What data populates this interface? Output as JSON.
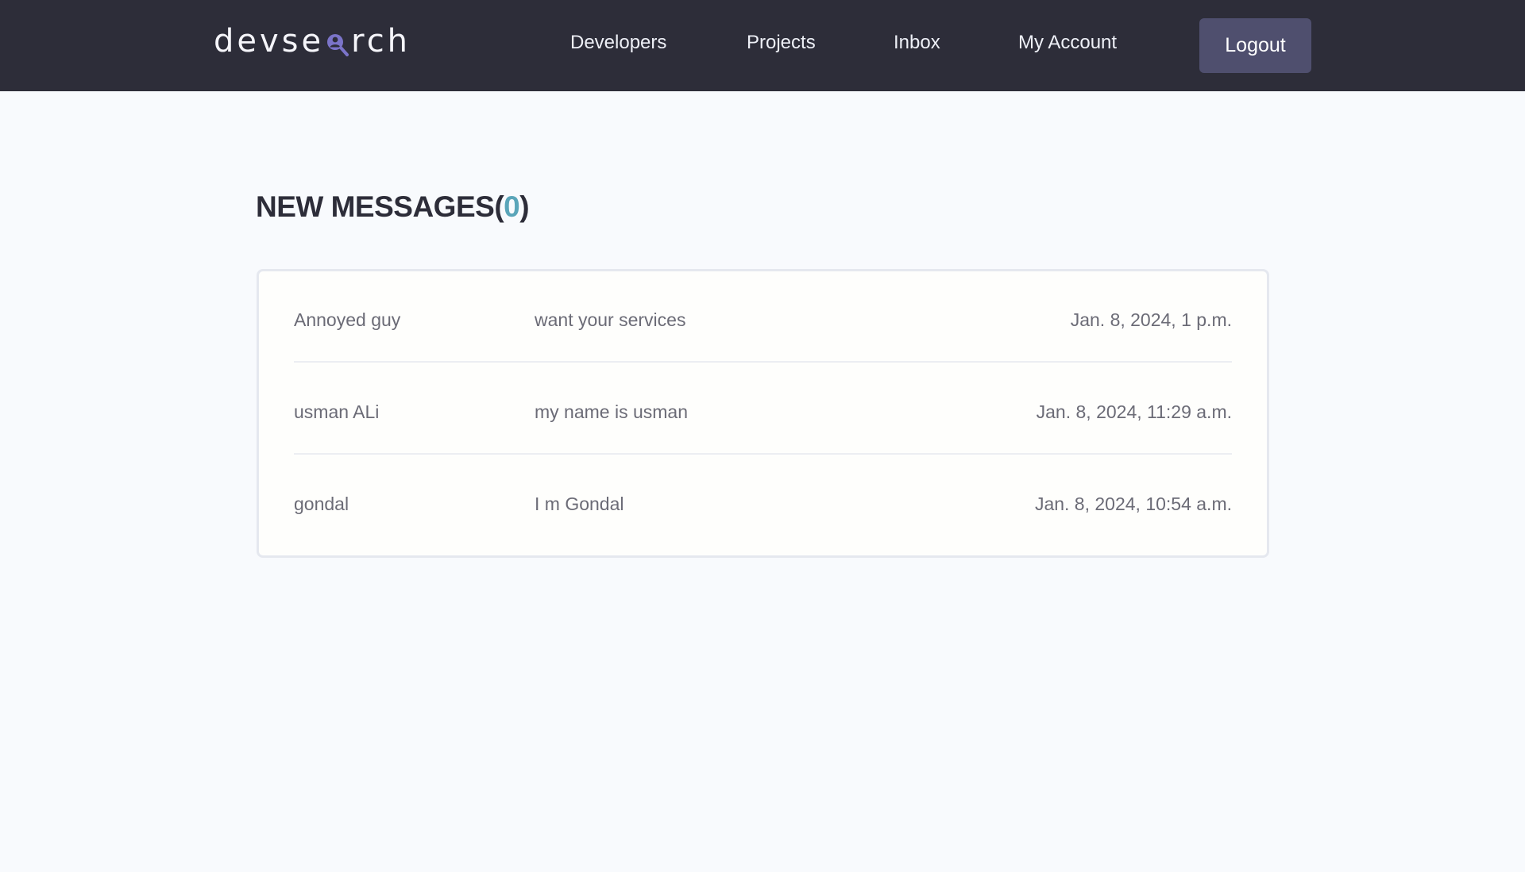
{
  "header": {
    "logo": {
      "prefix": "devse",
      "suffix": "rch",
      "icon": "magnifier-user-icon"
    },
    "nav": {
      "developers": "Developers",
      "projects": "Projects",
      "inbox": "Inbox",
      "my_account": "My Account",
      "logout": "Logout"
    }
  },
  "page": {
    "title": "NEW MESSAGES",
    "open_paren": "(",
    "unread_count": "0",
    "close_paren": ")"
  },
  "messages": [
    {
      "sender": "Annoyed guy",
      "subject": "want your services",
      "date": "Jan. 8, 2024, 1 p.m."
    },
    {
      "sender": "usman ALi",
      "subject": "my name is usman",
      "date": "Jan. 8, 2024, 11:29 a.m."
    },
    {
      "sender": "gondal",
      "subject": "I m Gondal",
      "date": "Jan. 8, 2024, 10:54 a.m."
    }
  ],
  "colors": {
    "header_bg": "#2d2d39",
    "logout_bg": "#4f4f6e",
    "accent_count": "#5aa5b9",
    "page_bg": "#f8fafd",
    "logo_icon": "#7b74c9"
  }
}
